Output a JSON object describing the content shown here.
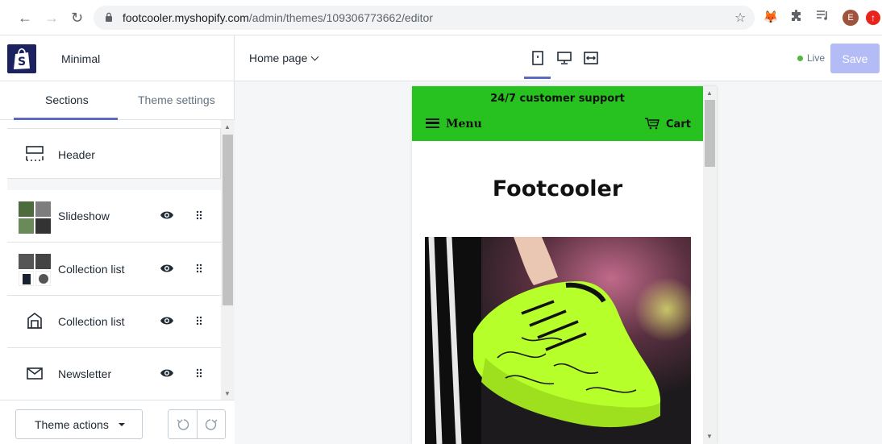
{
  "browser": {
    "url_host": "footcooler.myshopify.com",
    "url_path": "/admin/themes/109306773662/editor",
    "avatar_letter": "E"
  },
  "sidebar": {
    "theme_name": "Minimal",
    "tabs": [
      {
        "label": "Sections",
        "active": true
      },
      {
        "label": "Theme settings",
        "active": false
      }
    ],
    "sections": [
      {
        "label": "Header",
        "icon": "header-layout-icon"
      },
      {
        "label": "Slideshow",
        "icon": "slideshow-thumbnails"
      },
      {
        "label": "Collection list",
        "icon": "collection-thumbnails"
      },
      {
        "label": "Collection list",
        "icon": "collection-icon"
      },
      {
        "label": "Newsletter",
        "icon": "envelope-icon"
      }
    ],
    "theme_actions_label": "Theme actions"
  },
  "toolbar": {
    "page_select": "Home page",
    "status": "Live",
    "save_label": "Save",
    "colors": {
      "accent": "#5c6ac4",
      "save_disabled": "#b3bcf5",
      "live": "#50b83c"
    }
  },
  "preview": {
    "announcement": "24/7 customer support",
    "menu_label": "Menu",
    "cart_label": "Cart",
    "store_title": "Footcooler",
    "colors": {
      "announcement_bg": "#27c21f",
      "shoe": "#b6ff2a"
    }
  }
}
